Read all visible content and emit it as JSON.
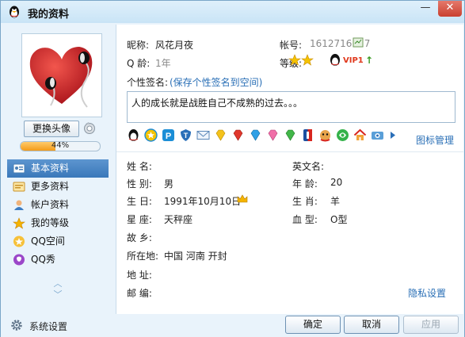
{
  "window": {
    "title": "我的资料",
    "minimize_glyph": "—",
    "close_glyph": "✕"
  },
  "left": {
    "change_avatar_label": "更换头像",
    "profile_completion_percent": 44,
    "profile_completion_text": "44%",
    "nav": [
      {
        "label": "基本资料",
        "icon": "id-card-icon",
        "active": true
      },
      {
        "label": "更多资料",
        "icon": "info-card-icon",
        "active": false
      },
      {
        "label": "帐户资料",
        "icon": "user-account-icon",
        "active": false
      },
      {
        "label": "我的等级",
        "icon": "level-badge-icon",
        "active": false
      },
      {
        "label": "QQ空间",
        "icon": "qzone-star-icon",
        "active": false
      },
      {
        "label": "QQ秀",
        "icon": "qqshow-icon",
        "active": false
      }
    ],
    "scroll_up_glyph": "︿",
    "scroll_down_glyph": "﹀"
  },
  "profile": {
    "nickname_label": "昵称:",
    "nickname": "风花月夜",
    "account_label": "帐号:",
    "account": "1612716127",
    "age_label": "Q 龄:",
    "age": "1年",
    "level_label": "等级:",
    "vip_text": "VIP1",
    "signature_label": "个性签名:",
    "save_signature_link": "(保存个性签名到空间)",
    "signature": "人的成长就是战胜自己不成熟的过去。。。",
    "icon_manage_link": "图标管理"
  },
  "basic": {
    "name_label": "姓    名:",
    "name": "",
    "english_name_label": "英文名:",
    "english_name": "",
    "gender_label": "性    别:",
    "gender": "男",
    "age_label": "年    龄:",
    "age": "20",
    "birthday_label": "生    日:",
    "birthday": "1991年10月10日",
    "zodiac_label": "生    肖:",
    "zodiac": "羊",
    "constellation_label": "星    座:",
    "constellation": "天秤座",
    "blood_label": "血    型:",
    "blood": "O型",
    "hometown_label": "故    乡:",
    "hometown": "",
    "location_label": "所在地:",
    "location": "中国  河南  开封",
    "address_label": "地    址:",
    "address": "",
    "zip_label": "邮    编:",
    "zip": "",
    "privacy_link": "隐私设置"
  },
  "footer": {
    "settings_label": "系统设置",
    "ok_label": "确定",
    "cancel_label": "取消",
    "apply_label": "应用"
  },
  "colors": {
    "accent": "#3a78ba",
    "link": "#2a6fb6",
    "progress": "#f39b1a"
  }
}
